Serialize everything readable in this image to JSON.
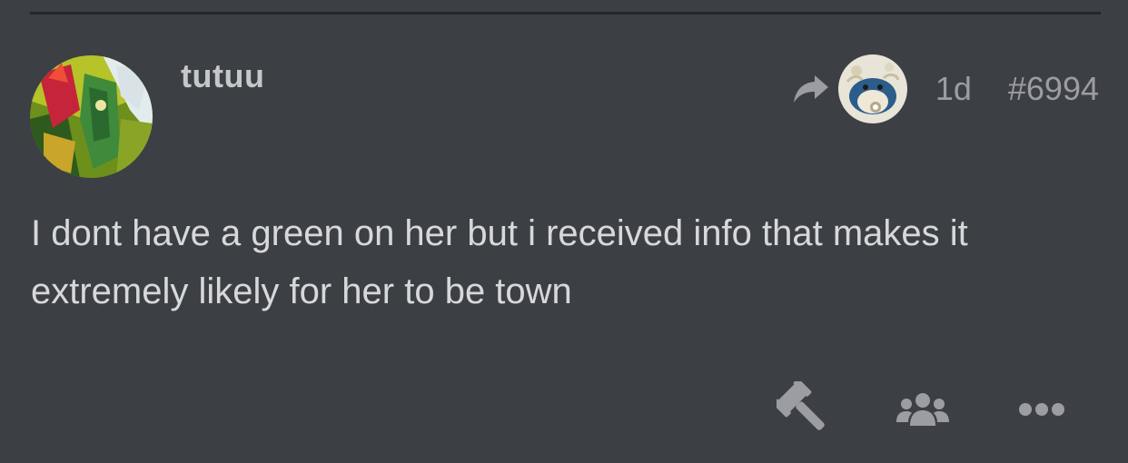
{
  "post": {
    "author": {
      "name": "tutuu",
      "avatar_icon": "avatar-illustration"
    },
    "reply_to": {
      "icon": "reply-arrow-icon",
      "avatar_icon": "reply-avatar"
    },
    "date": "1d",
    "number": "#6994",
    "body_lines": [
      "I dont have a green on her but i received info that makes it",
      "extremely likely for her to be town"
    ],
    "actions": [
      {
        "icon": "gavel-icon"
      },
      {
        "icon": "users-icon"
      },
      {
        "icon": "more-icon"
      }
    ]
  },
  "colors": {
    "background": "#3c3f44",
    "divider": "#24262a",
    "muted_text": "#9b9da2",
    "body_text": "#d7d8db"
  }
}
